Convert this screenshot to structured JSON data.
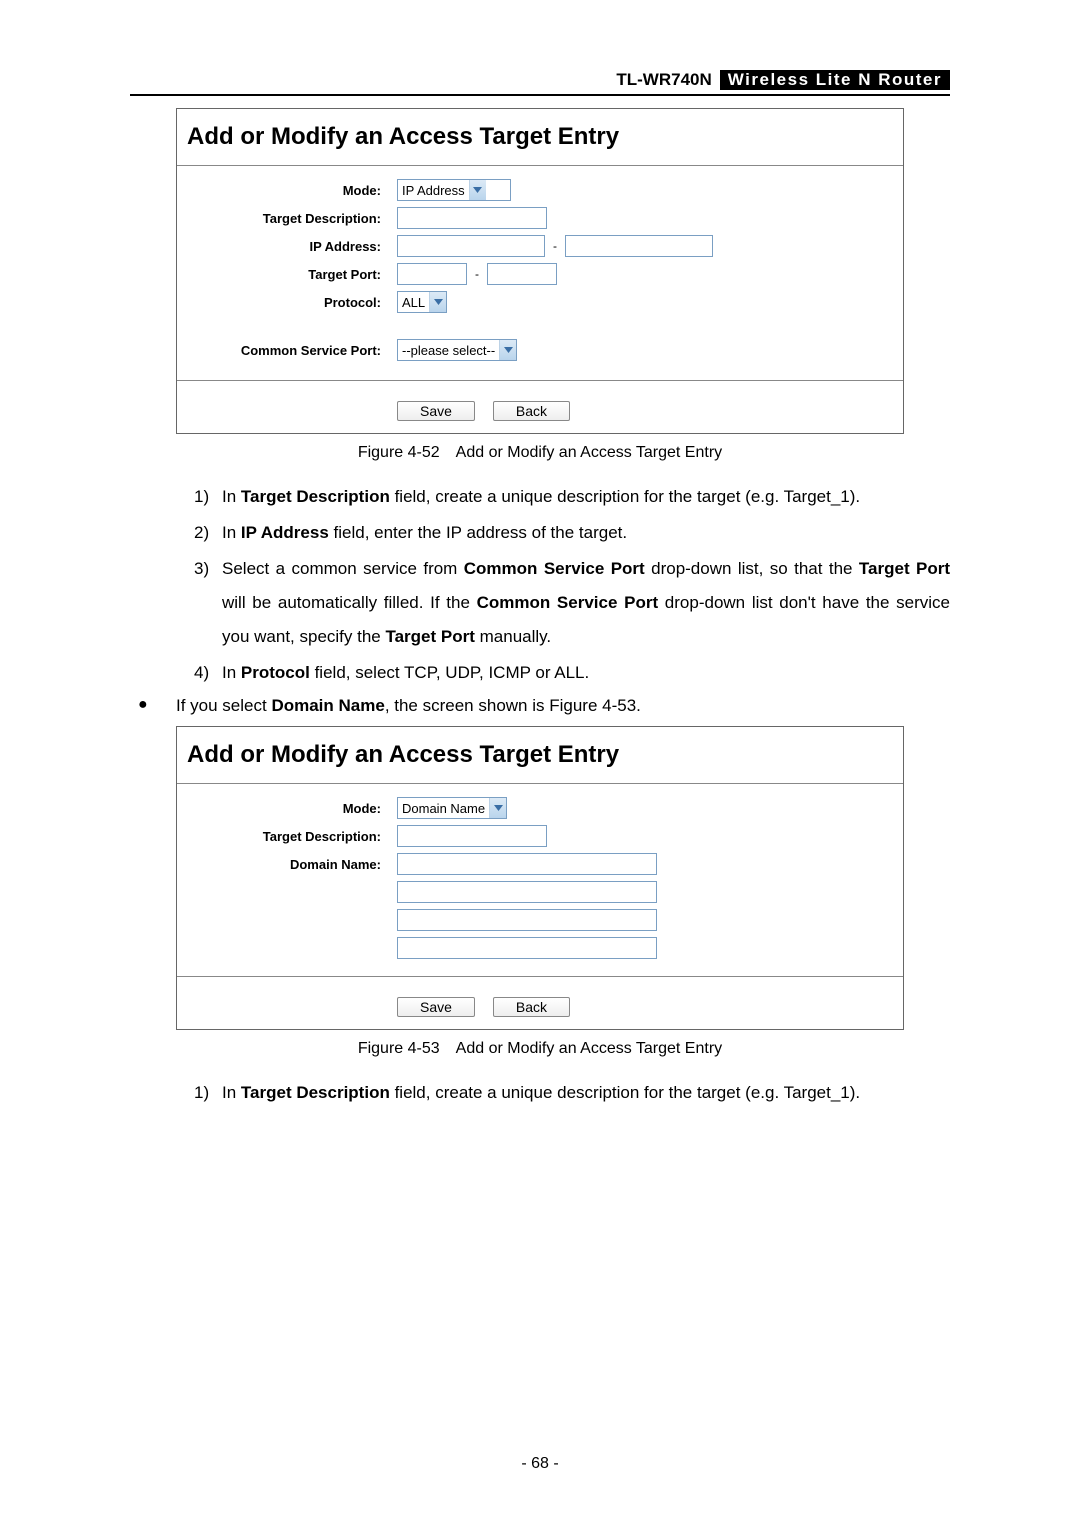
{
  "header": {
    "model": "TL-WR740N",
    "title": "Wireless  Lite  N   Router"
  },
  "fig1": {
    "heading": "Add or Modify an Access Target Entry",
    "labels": {
      "mode": "Mode:",
      "target_desc": "Target Description:",
      "ip_addr": "IP Address:",
      "target_port": "Target Port:",
      "protocol": "Protocol:",
      "common_port": "Common Service Port:"
    },
    "values": {
      "mode_select": "IP Address",
      "protocol_select": "ALL",
      "common_port_select": "--please select--"
    },
    "buttons": {
      "save": "Save",
      "back": "Back"
    },
    "caption": "Figure 4-52 Add or Modify an Access Target Entry"
  },
  "instructions1": {
    "i1_pre": "In ",
    "i1_b": "Target Description",
    "i1_post": " field, create a unique description for the target (e.g. Target_1).",
    "i2_pre": "In ",
    "i2_b": "IP Address",
    "i2_post": " field, enter the IP address of the target.",
    "i3_pre": "Select a common service from ",
    "i3_b1": "Common Service Port",
    "i3_mid1": " drop-down list, so that the ",
    "i3_b2": "Target Port",
    "i3_mid2": " will be automatically filled. If the ",
    "i3_b3": "Common Service Port",
    "i3_mid3": " drop-down list don't have the service you want, specify the ",
    "i3_b4": "Target Port",
    "i3_post": " manually.",
    "i4_pre": "In ",
    "i4_b": "Protocol",
    "i4_post": " field, select TCP, UDP, ICMP or ALL."
  },
  "bullet": {
    "pre": "If you select ",
    "b": "Domain Name",
    "post": ", the screen shown is Figure 4-53."
  },
  "fig2": {
    "heading": "Add or Modify an Access Target Entry",
    "labels": {
      "mode": "Mode:",
      "target_desc": "Target Description:",
      "domain_name": "Domain Name:"
    },
    "values": {
      "mode_select": "Domain Name"
    },
    "buttons": {
      "save": "Save",
      "back": "Back"
    },
    "caption": "Figure 4-53 Add or Modify an Access Target Entry"
  },
  "instructions2": {
    "i1_pre": "In ",
    "i1_b": "Target Description",
    "i1_post": " field, create a unique description for the target (e.g. Target_1)."
  },
  "page_number": "- 68 -"
}
